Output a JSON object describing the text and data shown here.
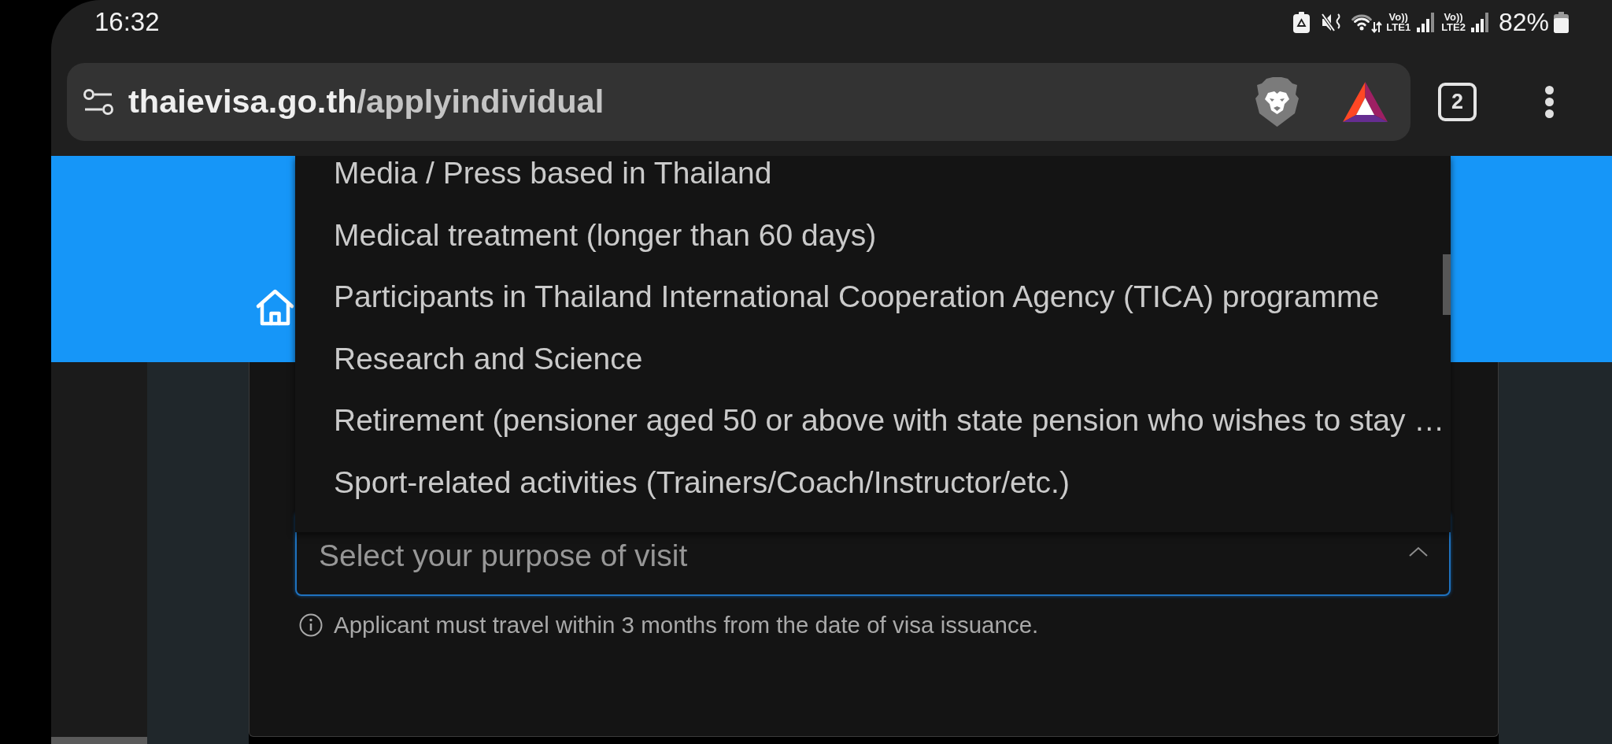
{
  "status_bar": {
    "time": "16:32",
    "sims": [
      {
        "volte": "Vo))",
        "network": "LTE1"
      },
      {
        "volte": "Vo))",
        "network": "LTE2"
      }
    ],
    "battery": "82%"
  },
  "browser": {
    "url": {
      "host": "thaievisa.go.th",
      "path": "/applyindividual"
    },
    "tab_count": "2"
  },
  "form": {
    "purpose_select": {
      "options": [
        {
          "label": "Media / Press based in Thailand",
          "selected": false
        },
        {
          "label": "Medical treatment (longer than 60 days)",
          "selected": false
        },
        {
          "label": "Participants in Thailand International Cooperation Agency (TICA) programme",
          "selected": false
        },
        {
          "label": "Research and Science",
          "selected": false
        },
        {
          "label": "Retirement (pensioner aged 50 or above with state pension who wishes to stay …",
          "selected": false
        },
        {
          "label": "Sport-related activities (Trainers/Coach/Instructor/etc.)",
          "selected": false
        }
      ],
      "placeholder": "Select your purpose of visit",
      "expanded": true
    },
    "helper_text": "Applicant must travel within 3 months from the date of visa issuance."
  }
}
